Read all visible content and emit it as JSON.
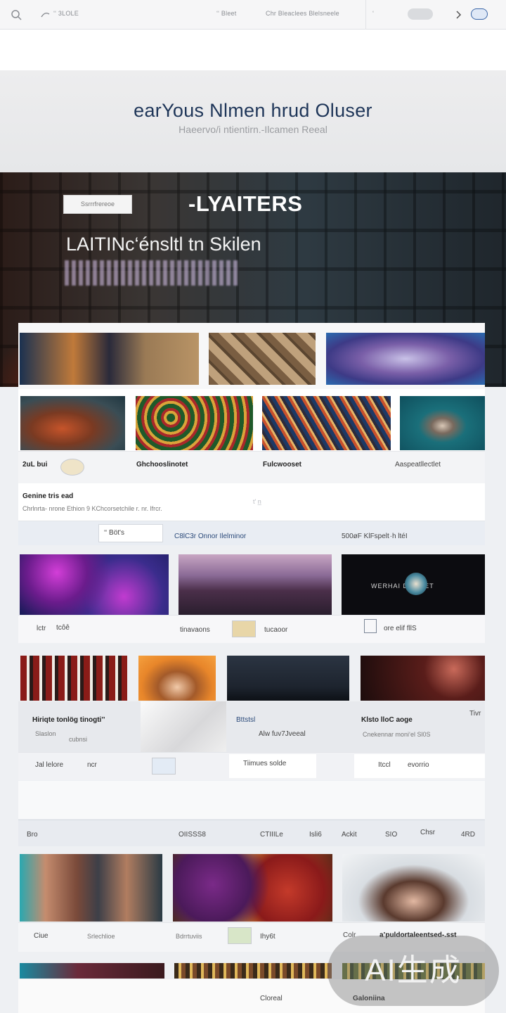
{
  "topbar": {
    "left_text": "‘‘ 3LOLE",
    "mid_text": "‘‘ Bleet",
    "mid_text2": "Chr Bleaclees Blelsneele",
    "right_text": "‘"
  },
  "header": {
    "title": "earYous Nlmen hrud Oluser",
    "subtitle": "Haeervo/i ntientirn.-Ilcamen Reeal"
  },
  "hero": {
    "button_label": "Ssrrrfrereoe",
    "title": "-LYAITERS",
    "line": "LAITINc‘énsltl tn Skilen"
  },
  "row2": {
    "labels": [
      "2uL bui",
      "Ghchooslinotet",
      "Fulcwooset",
      "Aaspeatllectlet"
    ],
    "footer_title": "Genine tris ead",
    "footer_sub": "Chrlnrta- nrone Ethion 9 KChcorsetchile r. nr. lfrcr.",
    "footer_small": "t' n̲",
    "bottom_left": "‘‘ Böt's",
    "bottom_mid": "C8lC3r Onnor Ilelminor",
    "bottom_right": "500øF KlFspelt ·h ltéI"
  },
  "row3": {
    "label1": "lctr",
    "label1b": "tcôê",
    "label2": "tinavaons",
    "label3": "tucaoor",
    "label4": "ore elif fllS",
    "card3_overlay": "WERHAI DSWAET"
  },
  "row4": {
    "title1": "Hiriqte tonlög tinogti’’",
    "sub1a": "Slaslon",
    "sub1b": "cubnsi",
    "label_mid": "Bttstsl",
    "label_mid2": "Alw fuv7Jveeal",
    "title3": "Klsto lloC aoge",
    "sub3": "Cnekennar moni‘el Sl0S",
    "tag3": "Tivr",
    "strip_a": "Jal lelore",
    "strip_b": "ncr",
    "strip_c": "Tiimues solde",
    "strip_d": "Itccl",
    "strip_e": "evorrio"
  },
  "listheader": {
    "items": [
      "Bro",
      "OIISSS8",
      "CTIIILe",
      "Isli6",
      "Ackit",
      "SIO",
      "Chsr",
      "4RD"
    ]
  },
  "row5": {
    "l1": "Ciue",
    "l2": "Srlechlioe",
    "l3": "Bdrrtuviis",
    "l4": "Ihy6t",
    "l5": "Colr",
    "l6": "a’puldortaleentsed-.sst"
  },
  "row6": {
    "l1": "Cloreal",
    "l2": "Galoniina"
  },
  "watermark": {
    "text": "AI生成"
  },
  "colors": {
    "title_blue": "#1e3558",
    "accent_blue": "#3a66a8"
  }
}
